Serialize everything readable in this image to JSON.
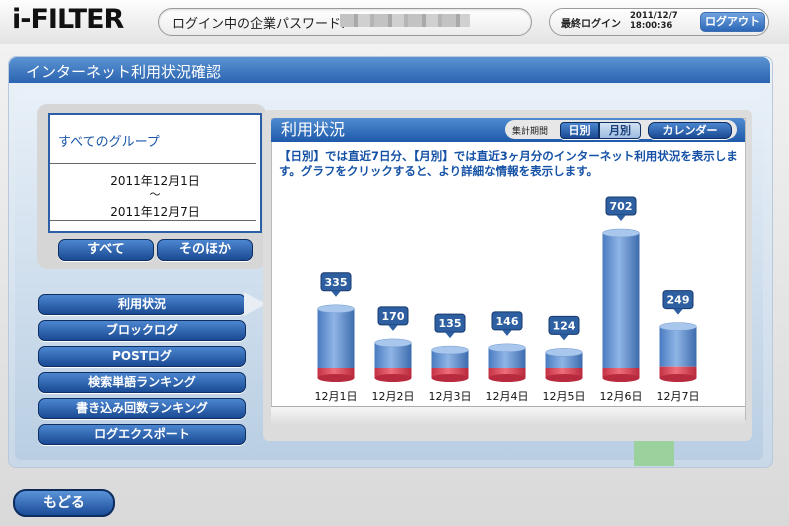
{
  "header": {
    "logo": "i-FILTER",
    "password_label": "ログイン中の企業パスワード:",
    "last_login_label": "最終ログイン",
    "last_login_date": "2011/12/7",
    "last_login_time": "18:00:36",
    "logout_label": "ログアウト"
  },
  "page_title": "インターネット利用状況確認",
  "group": {
    "name": "すべてのグループ",
    "date_start": "2011年12月1日",
    "tilde": "～",
    "date_end": "2011年12月7日",
    "btn_all": "すべて",
    "btn_other": "そのほか"
  },
  "menu": {
    "items": [
      {
        "label": "利用状況"
      },
      {
        "label": "ブロックログ"
      },
      {
        "label": "POSTログ"
      },
      {
        "label": "検索単語ランキング"
      },
      {
        "label": "書き込み回数ランキング"
      },
      {
        "label": "ログエクスポート"
      }
    ]
  },
  "panel": {
    "title": "利用状況",
    "period_label": "集計期間",
    "daily_label": "日別",
    "monthly_label": "月別",
    "calendar_label": "カレンダー",
    "description": "【日別】では直近7日分、【月別】では直近3ヶ月分のインターネット利用状況を表示します。グラフをクリックすると、より詳細な情報を表示します。"
  },
  "chart_data": {
    "type": "bar",
    "categories": [
      "12月1日",
      "12月2日",
      "12月3日",
      "12月4日",
      "12月5日",
      "12月6日",
      "12月7日"
    ],
    "values": [
      335,
      170,
      135,
      146,
      124,
      702,
      249
    ],
    "blocked_fraction": [
      0.05,
      0.09,
      0.11,
      0.11,
      0.12,
      0.05,
      0.22
    ],
    "colors": {
      "bar": "#5f8fd0",
      "blocked": "#d8485a",
      "label_bg": "#2d5fa1"
    }
  },
  "footer": {
    "back_label": "もどる"
  }
}
